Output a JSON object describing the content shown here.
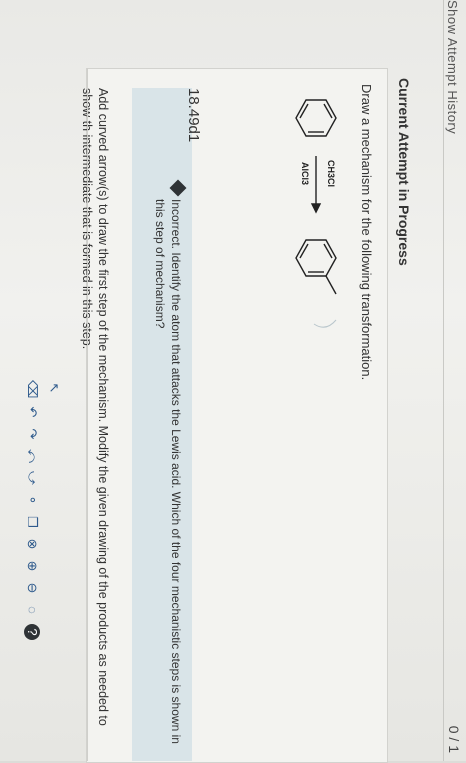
{
  "header": {
    "attempt_history": "Show Attempt History",
    "score": "0 / 1"
  },
  "question": {
    "status": "Current Attempt in Progress",
    "prompt": "Draw a mechanism for the following transformation.",
    "reagent_top": "CH3Cl",
    "reagent_bottom": "AlCl3",
    "question_id": "18.49d1"
  },
  "feedback": {
    "text": "Incorrect. Identify the atom that attacks the Lewis acid. Which of the four mechanistic steps is shown in this step of mechanism?"
  },
  "instructions": {
    "text": "Add curved arrow(s) to draw the first step of the mechanism. Modify the given drawing of the products as needed to show th intermediate that is formed in this step."
  },
  "toolbar": {
    "icons": [
      "select-arrow-icon",
      "eraser-icon",
      "undo-icon",
      "redo-icon",
      "curved-arrow-icon",
      "single-curved-arrow-icon",
      "atom-tool-icon",
      "copy-icon",
      "close-icon",
      "zoom-in-icon",
      "zoom-out-icon",
      "lasso-icon",
      "help-icon"
    ]
  },
  "colors": {
    "feedback_bg": "#d9e4e8",
    "toolbar_icon": "#2e5a8c",
    "feedback_icon": "#2f3336"
  }
}
